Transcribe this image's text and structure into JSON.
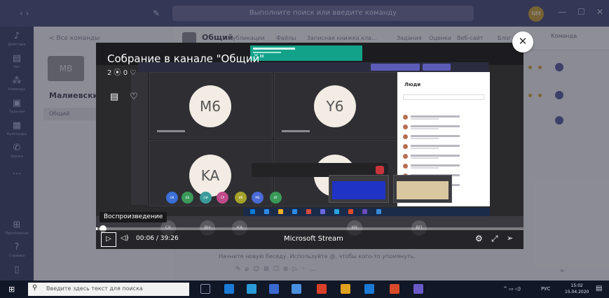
{
  "teams": {
    "search_placeholder": "Выполните поиск или введите команду",
    "user_initials": "NM",
    "win_controls": [
      "—",
      "☐",
      "✕"
    ],
    "back_label": "< Все команды",
    "team_tile": "MB",
    "team_name": "Малиевски",
    "channel": "Общий",
    "channel_title": "Общий",
    "channel_tabs": [
      "Публикации",
      "Файлы",
      "Записная книжка кла...",
      "Задания",
      "Оценки",
      "Веб-сайт",
      "Блог"
    ],
    "team_button": "Команда",
    "new_conversation": "Начните новую беседу. Используйте @, чтобы кого-то упомянуть.",
    "rail": [
      {
        "icon": "bell-icon",
        "label": "Действия"
      },
      {
        "icon": "chat-icon",
        "label": "Чат"
      },
      {
        "icon": "teams-icon",
        "label": "Команды"
      },
      {
        "icon": "assignments-icon",
        "label": "Задания"
      },
      {
        "icon": "calendar-icon",
        "label": "Календарь"
      },
      {
        "icon": "calls-icon",
        "label": "Звонки"
      },
      {
        "icon": "more-icon",
        "label": "..."
      },
      {
        "icon": "apps-icon",
        "label": "Приложения"
      },
      {
        "icon": "help-icon",
        "label": "Справка"
      },
      {
        "icon": "device-icon",
        "label": ""
      }
    ]
  },
  "player": {
    "title": "Собрание в канале \"Общий\"",
    "stats": "2 ⦿  0 ♡",
    "tooltip": "Воспроизведение",
    "current_time": "00:06",
    "separator": "/",
    "duration": "39:26",
    "brand": "Microsoft Stream",
    "progress": 0.0025,
    "close": "✕"
  },
  "recording": {
    "tiles": [
      {
        "initials": "M6"
      },
      {
        "initials": "Y6"
      },
      {
        "initials": "KA"
      }
    ],
    "people_header": "Люди",
    "strip": [
      "ОК",
      "ЕВ",
      "ОИ",
      "СР",
      "ИВ",
      "МБ",
      "ИГ"
    ],
    "bottom_avatars": [
      "СК",
      "ВН",
      "КА",
      "ИХ",
      "ВП"
    ]
  },
  "taskbar": {
    "search_text": "Введите здесь текст для поиска",
    "lang": "РУС",
    "time": "15:02",
    "date": "15.04.2020"
  },
  "colors": {
    "teams_purple": "#4a4f7a",
    "accent": "#5d5bb8",
    "hangup": "#c9343b"
  }
}
